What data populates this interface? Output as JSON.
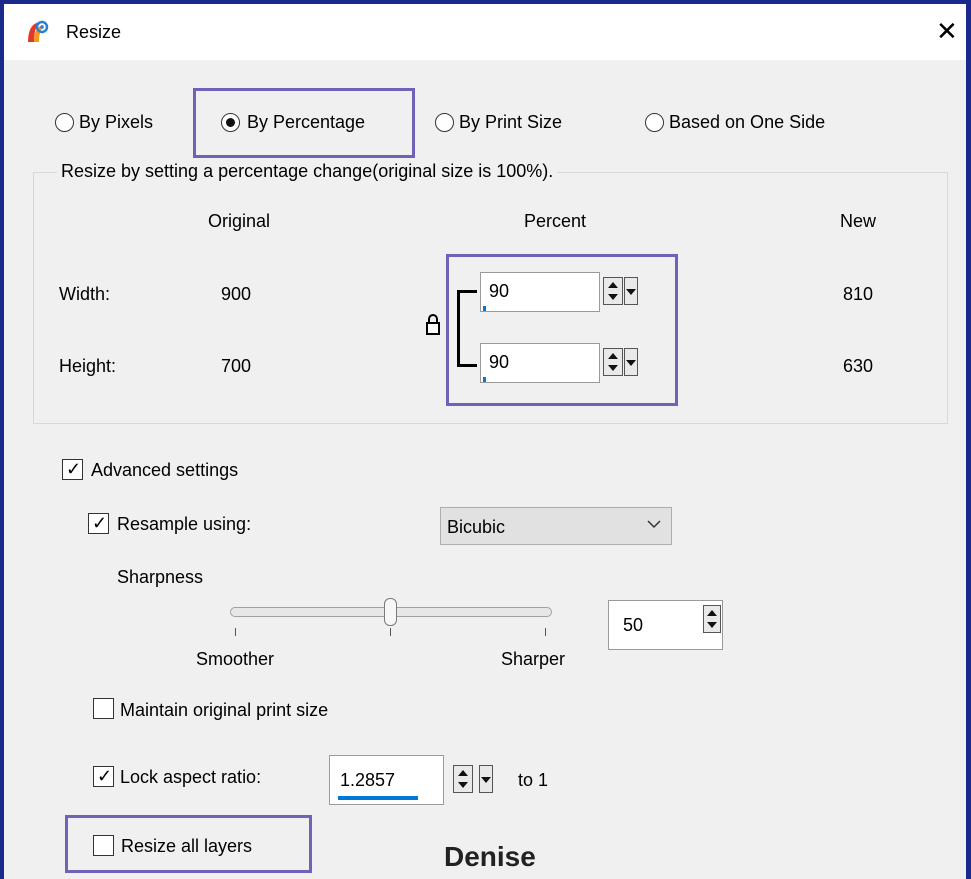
{
  "window": {
    "title": "Resize",
    "close_glyph": "✕"
  },
  "mode_options": [
    {
      "label": "By Pixels",
      "selected": false
    },
    {
      "label": "By Percentage",
      "selected": true
    },
    {
      "label": "By Print Size",
      "selected": false
    },
    {
      "label": "Based on One Side",
      "selected": false
    }
  ],
  "group": {
    "title": "Resize by setting a percentage change(original size is 100%).",
    "columns": {
      "original": "Original",
      "percent": "Percent",
      "new": "New"
    },
    "rows": [
      {
        "label": "Width:",
        "original": "900",
        "percent": "90",
        "new": "810"
      },
      {
        "label": "Height:",
        "original": "700",
        "percent": "90",
        "new": "630"
      }
    ],
    "lock_icon": "padlock-icon"
  },
  "advanced": {
    "label": "Advanced settings",
    "checked": true,
    "resample": {
      "label": "Resample using:",
      "checked": true,
      "method": "Bicubic"
    },
    "sharpness": {
      "label": "Sharpness",
      "value": "50",
      "level": 50,
      "min_label": "Smoother",
      "max_label": "Sharper"
    },
    "maintain_print": {
      "label": "Maintain original print size",
      "checked": false
    },
    "lock_aspect": {
      "label": "Lock aspect ratio:",
      "checked": true,
      "value": "1.2857",
      "suffix": "to 1"
    },
    "resize_layers": {
      "label": "Resize all layers",
      "checked": false
    }
  },
  "watermark": "Denise",
  "colors": {
    "highlight": "#6f63b8",
    "frame": "#1a2a8a",
    "dialog_bg": "#f0f0f0",
    "caret_blue": "#0078d7"
  }
}
